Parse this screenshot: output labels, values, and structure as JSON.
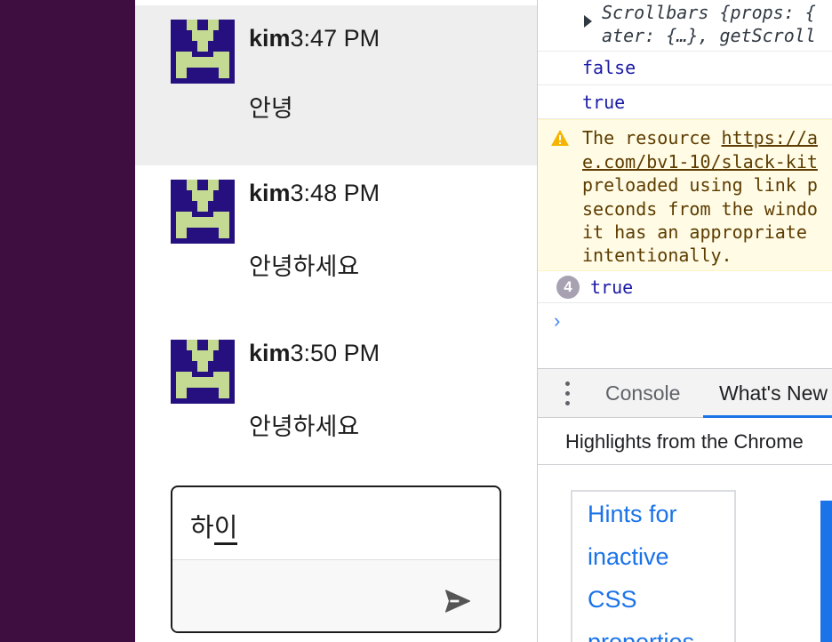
{
  "colors": {
    "sidebar": "#3f0e40",
    "highlight_row": "#eeeeee",
    "avatar_bg": "#26107f",
    "avatar_fg": "#c4d992",
    "accent": "#1a73e8",
    "warning_bg": "#fffbe5"
  },
  "chat": {
    "messages": [
      {
        "author": "kim",
        "time": "3:47 PM",
        "text": "안녕",
        "highlighted": true
      },
      {
        "author": "kim",
        "time": "3:48 PM",
        "text": "안녕하세요",
        "highlighted": false
      },
      {
        "author": "kim",
        "time": "3:50 PM",
        "text": "안녕하세요",
        "highlighted": false
      }
    ],
    "composer": {
      "text_committed": "하",
      "text_composing": "이",
      "send_icon": "send-icon"
    }
  },
  "devtools": {
    "console": {
      "scrollbars_line1": "Scrollbars {props: {",
      "scrollbars_line2": "ater: {…}, getScroll",
      "value_false": "false",
      "value_true": "true",
      "warning": {
        "prefix": "The resource ",
        "link": "https://a",
        "lines": [
          "e.com/bv1-10/slack-kit",
          "preloaded using link p",
          "seconds from the windo",
          "it has an appropriate",
          "intentionally."
        ]
      },
      "repeat_count": "4",
      "repeat_value": "true",
      "prompt": "›"
    },
    "drawer": {
      "tabs": [
        "Console",
        "What's New"
      ],
      "highlights_title": "Highlights from the Chrome",
      "card_lines": [
        "Hints for",
        "inactive",
        "CSS",
        "properties"
      ]
    }
  }
}
